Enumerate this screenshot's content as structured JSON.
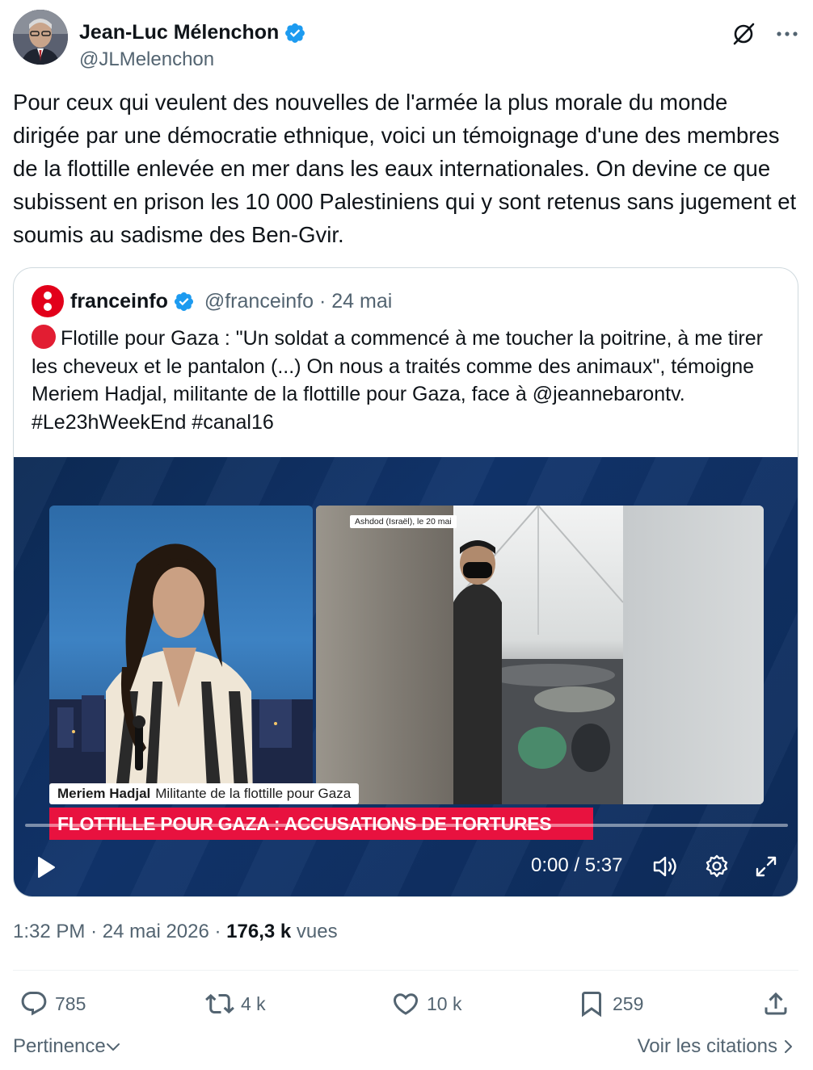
{
  "author": {
    "name": "Jean-Luc Mélenchon",
    "handle": "@JLMelenchon"
  },
  "tweet_text": "Pour ceux qui veulent des nouvelles de l'armée la plus morale du monde dirigée par une démocratie ethnique, voici un témoignage d'une des membres de la flottille enlevée en mer dans les eaux internationales. On devine ce que subissent en prison les 10 000 Palestiniens qui y sont retenus sans jugement et soumis au sadisme des Ben-Gvir.",
  "quote": {
    "name": "franceinfo",
    "handle": "@franceinfo",
    "sep": "·",
    "date": "24 mai",
    "text": "Flotille pour Gaza : \"Un soldat a commencé à me toucher la poitrine, à me tirer les cheveux et le pantalon (...) On nous a traités comme des animaux\", témoigne Meriem Hadjal, militante de la flottille pour Gaza, face à @jeannebarontv. #Le23hWeekEnd #canal16",
    "video": {
      "location_tag": "Ashdod (Israël), le 20 mai",
      "speaker_name": "Meriem Hadjal",
      "speaker_title": "Militante de la flottille pour Gaza",
      "headline": "FLOTTILLE POUR GAZA : ACCUSATIONS DE TORTURES",
      "time": "0:00 / 5:37",
      "progress_fraction": 0
    }
  },
  "meta": {
    "time": "1:32 PM",
    "sep1": "·",
    "date": "24 mai 2026",
    "sep2": "·",
    "views_count": "176,3 k",
    "views_label": "vues"
  },
  "actions": {
    "replies": "785",
    "reposts": "4 k",
    "likes": "10 k",
    "bookmarks": "259"
  },
  "footer": {
    "sort_label": "Pertinence",
    "quotes_link": "Voir les citations"
  },
  "colors": {
    "accent": "#1d9bf0",
    "text": "#0f1419",
    "muted": "#536471",
    "franceinfo_red": "#e2001a",
    "headline_red": "#e8123f"
  }
}
